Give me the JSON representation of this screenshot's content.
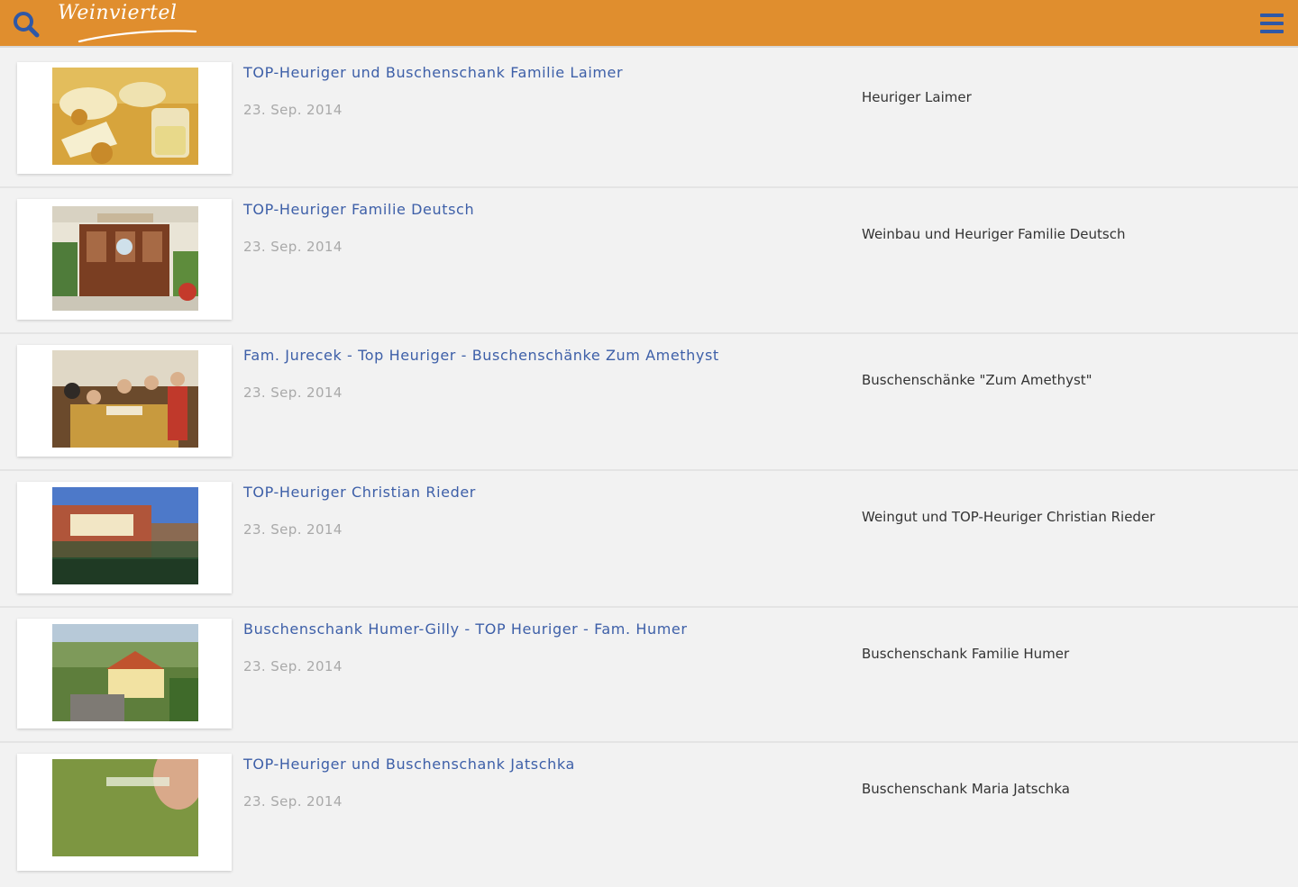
{
  "header": {
    "logo_text": "Weinviertel",
    "bar_color": "#e08e2e",
    "search_icon": "search-icon",
    "menu_icon": "hamburger-menu-icon"
  },
  "items": [
    {
      "title": "TOP-Heuriger und Buschenschank Familie Laimer",
      "date": "23. Sep. 2014",
      "venue": "Heuriger Laimer"
    },
    {
      "title": "TOP-Heuriger Familie Deutsch",
      "date": "23. Sep. 2014",
      "venue": "Weinbau und Heuriger Familie Deutsch"
    },
    {
      "title": "Fam. Jurecek - Top Heuriger - Buschenschänke Zum Amethyst",
      "date": "23. Sep. 2014",
      "venue": "Buschenschänke \"Zum Amethyst\""
    },
    {
      "title": "TOP-Heuriger Christian Rieder",
      "date": "23. Sep. 2014",
      "venue": "Weingut und TOP-Heuriger Christian Rieder"
    },
    {
      "title": "Buschenschank Humer-Gilly - TOP Heuriger - Fam. Humer",
      "date": "23. Sep. 2014",
      "venue": "Buschenschank Familie Humer"
    },
    {
      "title": "TOP-Heuriger und Buschenschank Jatschka",
      "date": "23. Sep. 2014",
      "venue": "Buschenschank Maria Jatschka"
    }
  ]
}
